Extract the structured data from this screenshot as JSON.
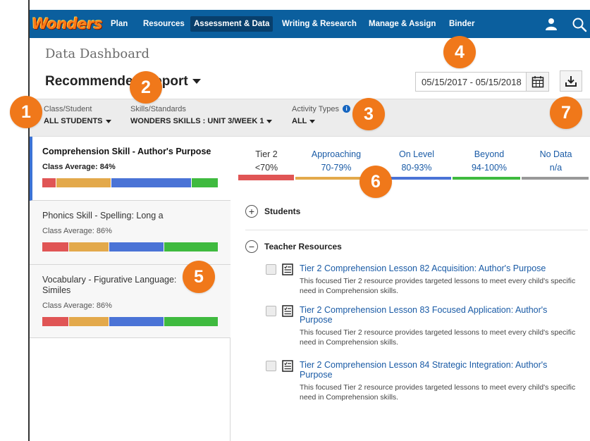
{
  "nav": {
    "logo": "Wonders",
    "items": [
      {
        "label": "Plan"
      },
      {
        "label": "Resources"
      },
      {
        "label": "Assessment & Data",
        "active": true
      },
      {
        "label": "Writing & Research"
      },
      {
        "label": "Manage & Assign"
      },
      {
        "label": "Binder"
      }
    ],
    "icons": [
      "user-icon",
      "search-icon"
    ]
  },
  "page": {
    "title": "Data Dashboard",
    "report_title": "Recommended Report"
  },
  "date_range": {
    "value": "05/15/2017 - 05/15/2018"
  },
  "filters": {
    "class_student": {
      "label": "Class/Student",
      "value": "ALL STUDENTS"
    },
    "skills": {
      "label": "Skills/Standards",
      "value": "WONDERS SKILLS : UNIT 3/WEEK 1"
    },
    "activity": {
      "label": "Activity Types",
      "value": "ALL"
    }
  },
  "skills_list": [
    {
      "title": "Comprehension Skill - Author's Purpose",
      "average": "Class Average: 84%",
      "selected": true,
      "segments": [
        0.08,
        0.31,
        0.46,
        0.15
      ]
    },
    {
      "title": "Phonics Skill - Spelling: Long a",
      "average": "Class Average: 86%",
      "selected": false,
      "segments": [
        0.15,
        0.23,
        0.31,
        0.31
      ]
    },
    {
      "title": "Vocabulary - Figurative Language: Similes",
      "average": "Class Average: 86%",
      "selected": false,
      "segments": [
        0.15,
        0.23,
        0.31,
        0.31
      ]
    }
  ],
  "tiers": [
    {
      "name": "Tier 2",
      "range": "<70%",
      "color": "#e05555",
      "active": true
    },
    {
      "name": "Approaching",
      "range": "70-79%",
      "color": "#e3a94b",
      "active": false
    },
    {
      "name": "On Level",
      "range": "80-93%",
      "color": "#4a73d6",
      "active": false
    },
    {
      "name": "Beyond",
      "range": "94-100%",
      "color": "#3fba3f",
      "active": false
    },
    {
      "name": "No Data",
      "range": "n/a",
      "color": "#999999",
      "active": false
    }
  ],
  "sections": {
    "students": {
      "label": "Students",
      "expanded": false
    },
    "teacher_resources": {
      "label": "Teacher Resources",
      "expanded": true
    }
  },
  "resources": [
    {
      "title": "Tier 2 Comprehension Lesson 82 Acquisition: Author's Purpose",
      "description": "This focused Tier 2 resource provides targeted lessons to meet every child's specific need in Comprehension skills."
    },
    {
      "title": "Tier 2 Comprehension Lesson 83 Focused Application: Author's Purpose",
      "description": "This focused Tier 2 resource provides targeted lessons to meet every child's specific need in Comprehension skills."
    },
    {
      "title": "Tier 2 Comprehension Lesson 84 Strategic Integration: Author's Purpose",
      "description": "This focused Tier 2 resource provides targeted lessons to meet every child's specific need in Comprehension skills."
    }
  ],
  "callouts": [
    "1",
    "2",
    "3",
    "4",
    "5",
    "6",
    "7"
  ],
  "colors": {
    "nav_bg": "#0b5f9e",
    "accent": "#f0781a",
    "link": "#1a5ba6",
    "red": "#e05555",
    "orange": "#e3a94b",
    "blue": "#4a73d6",
    "green": "#3fba3f"
  }
}
